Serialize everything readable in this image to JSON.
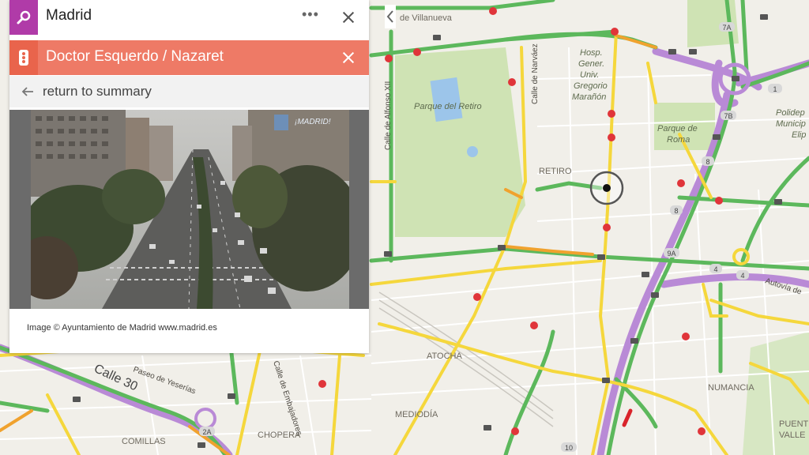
{
  "search": {
    "query": "Madrid"
  },
  "detail": {
    "title": "Doctor Esquerdo / Nazaret",
    "back_label": "return to summary",
    "image_credit": "Image © Ayuntamiento de Madrid www.madrid.es",
    "watermark": "¡MADRID!"
  },
  "map": {
    "labels": {
      "villanueva": "de Villanueva",
      "retiro_park": "Parque del Retiro",
      "narvaez": "Calle de Narváez",
      "hosp_1": "Hosp.",
      "hosp_2": "Gener.",
      "hosp_3": "Univ.",
      "hosp_4": "Gregorio",
      "hosp_5": "Marañón",
      "alfonso": "Calle de Alfonso XII",
      "roma_1": "Parque de",
      "roma_2": "Roma",
      "poli_1": "Polidep",
      "poli_2": "Municip",
      "poli_3": "Elip",
      "retiro": "RETIRO",
      "atocha": "ATOCHA",
      "numancia": "NUMANCIA",
      "mediodia": "MEDIODÍA",
      "chopera": "CHOPERA",
      "comillas": "COMILLAS",
      "puente_1": "PUENT",
      "puente_2": "VALLE",
      "calle30": "Calle 30",
      "yeserias": "Paseo de Yeserías",
      "embajadores": "Calle de Embajadores",
      "autovia": "Autovía de"
    },
    "shields": [
      "7A",
      "7B",
      "1",
      "8",
      "8",
      "9A",
      "4",
      "4",
      "2A",
      "10"
    ],
    "colors": {
      "green": "#5cb85c",
      "yellow": "#f5d73c",
      "orange": "#f0a22e",
      "purple": "#b98ad6",
      "park": "#cfe3b4",
      "red": "#d9242b"
    }
  }
}
